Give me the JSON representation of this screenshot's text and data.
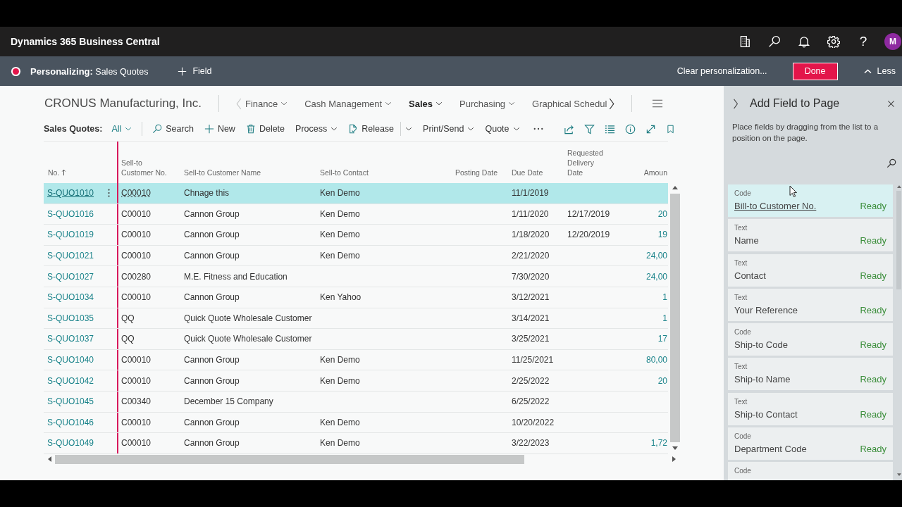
{
  "top_bar": {
    "title": "Dynamics 365 Business Central",
    "help": "?",
    "avatar": "M"
  },
  "personalize_bar": {
    "label": "**Personalizing:** Sales Quotes",
    "add_field": "Field",
    "clear": "Clear personalization...",
    "done": "Done",
    "less": "Less"
  },
  "page": {
    "company": "CRONUS Manufacturing, Inc.",
    "nav_prev_enabled": false,
    "nav_next_enabled": true,
    "nav": [
      {
        "label": "Finance",
        "selected": false
      },
      {
        "label": "Cash Management",
        "selected": false
      },
      {
        "label": "Sales",
        "selected": true
      },
      {
        "label": "Purchasing",
        "selected": false
      },
      {
        "label": "Graphical Schedul",
        "selected": false
      }
    ]
  },
  "action_bar": {
    "title": "Sales Quotes:",
    "filter": "All",
    "actions": [
      {
        "kind": "button",
        "label": "Search"
      },
      {
        "kind": "button",
        "label": "New"
      },
      {
        "kind": "button",
        "label": "Delete"
      },
      {
        "kind": "menu",
        "label": "Process"
      },
      {
        "kind": "split",
        "label": "Release"
      },
      {
        "kind": "menu",
        "label": "Print/Send"
      },
      {
        "kind": "menu",
        "label": "Quote"
      }
    ]
  },
  "table": {
    "columns": [
      {
        "label": "No.",
        "sorted": true
      },
      {
        "label": "Sell-to Customer No.",
        "sorted": false
      },
      {
        "label": "Sell-to Customer Name",
        "sorted": false
      },
      {
        "label": "Sell-to Contact",
        "sorted": false
      },
      {
        "label": "Posting Date",
        "sorted": false
      },
      {
        "label": "Due Date",
        "sorted": false
      },
      {
        "label": "Requested Delivery Date",
        "sorted": false
      },
      {
        "label": "Amoun",
        "sorted": false
      }
    ],
    "rows": [
      {
        "no": "S-QUO1010",
        "customer_no": "C00010",
        "customer_name": "Chnage this",
        "contact": "Ken Demo",
        "due_date": "11/1/2019",
        "selected": true
      },
      {
        "no": "S-QUO1016",
        "customer_no": "C00010",
        "customer_name": "Cannon Group",
        "contact": "Ken Demo",
        "due_date": "1/11/2020",
        "requested_delivery_date": "12/17/2019",
        "amount": "20",
        "selected": false
      },
      {
        "no": "S-QUO1019",
        "customer_no": "C00010",
        "customer_name": "Cannon Group",
        "contact": "Ken Demo",
        "due_date": "1/18/2020",
        "requested_delivery_date": "12/20/2019",
        "amount": "19",
        "selected": false
      },
      {
        "no": "S-QUO1021",
        "customer_no": "C00010",
        "customer_name": "Cannon Group",
        "contact": "Ken Demo",
        "due_date": "2/21/2020",
        "amount": "24,00",
        "selected": false
      },
      {
        "no": "S-QUO1027",
        "customer_no": "C00280",
        "customer_name": "M.E. Fitness and Education",
        "due_date": "7/30/2020",
        "amount": "24,00",
        "selected": false
      },
      {
        "no": "S-QUO1034",
        "customer_no": "C00010",
        "customer_name": "Cannon Group",
        "contact": "Ken Yahoo",
        "due_date": "3/12/2021",
        "amount": "1",
        "selected": false
      },
      {
        "no": "S-QUO1035",
        "customer_no": "QQ",
        "customer_name": "Quick Quote Wholesale Customer",
        "due_date": "3/14/2021",
        "amount": "1",
        "selected": false
      },
      {
        "no": "S-QUO1037",
        "customer_no": "QQ",
        "customer_name": "Quick Quote Wholesale Customer",
        "due_date": "3/25/2021",
        "amount": "17",
        "selected": false
      },
      {
        "no": "S-QUO1040",
        "customer_no": "C00010",
        "customer_name": "Cannon Group",
        "contact": "Ken Demo",
        "due_date": "11/25/2021",
        "amount": "80,00",
        "selected": false
      },
      {
        "no": "S-QUO1042",
        "customer_no": "C00010",
        "customer_name": "Cannon Group",
        "contact": "Ken Demo",
        "due_date": "2/25/2022",
        "amount": "20",
        "selected": false
      },
      {
        "no": "S-QUO1045",
        "customer_no": "C00340",
        "customer_name": "December 15 Company",
        "due_date": "6/25/2022",
        "selected": false
      },
      {
        "no": "S-QUO1046",
        "customer_no": "C00010",
        "customer_name": "Cannon Group",
        "contact": "Ken Demo",
        "due_date": "10/20/2022",
        "selected": false
      },
      {
        "no": "S-QUO1049",
        "customer_no": "C00010",
        "customer_name": "Cannon Group",
        "contact": "Ken Demo",
        "due_date": "3/22/2023",
        "amount": "1,72",
        "selected": false
      }
    ]
  },
  "field_panel": {
    "title": "Add Field to Page",
    "description": "Place fields by dragging from the list to a position on the page.",
    "fields": [
      {
        "type": "Code",
        "name": "Bill-to Customer No.",
        "status": "Ready",
        "selected": true
      },
      {
        "type": "Text",
        "name": "Name",
        "status": "Ready",
        "selected": false
      },
      {
        "type": "Text",
        "name": "Contact",
        "status": "Ready",
        "selected": false
      },
      {
        "type": "Text",
        "name": "Your Reference",
        "status": "Ready",
        "selected": false
      },
      {
        "type": "Code",
        "name": "Ship-to Code",
        "status": "Ready",
        "selected": false
      },
      {
        "type": "Text",
        "name": "Ship-to Name",
        "status": "Ready",
        "selected": false
      },
      {
        "type": "Text",
        "name": "Ship-to Contact",
        "status": "Ready",
        "selected": false
      },
      {
        "type": "Code",
        "name": "Department Code",
        "status": "Ready",
        "selected": false
      },
      {
        "type": "Code",
        "selected": false
      }
    ]
  }
}
